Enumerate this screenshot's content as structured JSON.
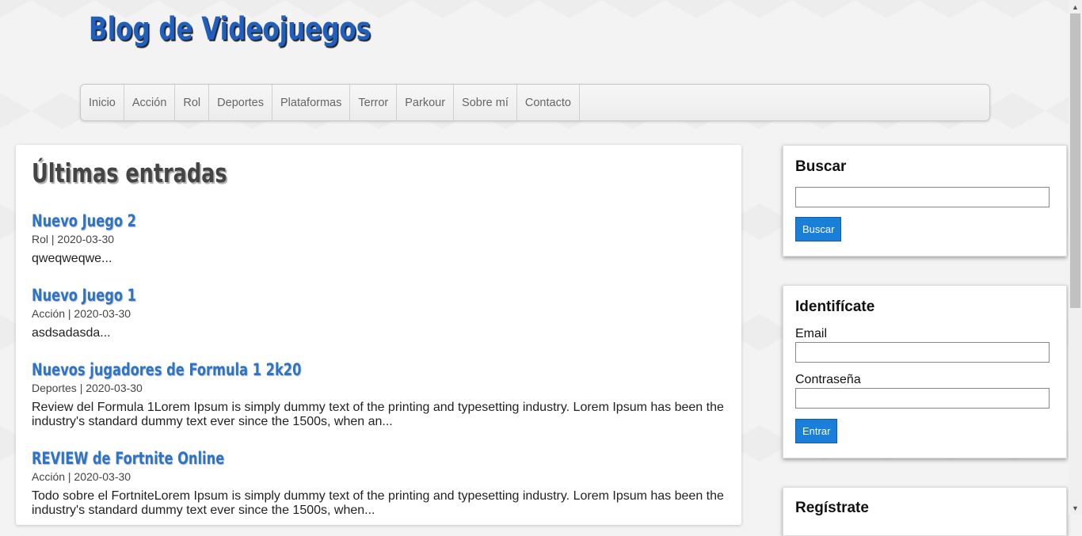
{
  "site": {
    "title": "Blog de Videojuegos"
  },
  "nav": {
    "items": [
      "Inicio",
      "Acción",
      "Rol",
      "Deportes",
      "Plataformas",
      "Terror",
      "Parkour",
      "Sobre mí",
      "Contacto"
    ]
  },
  "main": {
    "heading": "Últimas entradas",
    "posts": [
      {
        "title": "Nuevo Juego 2",
        "meta": "Rol | 2020-03-30",
        "excerpt": "qweqweqwe..."
      },
      {
        "title": "Nuevo Juego 1",
        "meta": "Acción | 2020-03-30",
        "excerpt": "asdsadasda..."
      },
      {
        "title": "Nuevos jugadores de Formula 1 2k20",
        "meta": "Deportes | 2020-03-30",
        "excerpt": "Review del Formula 1Lorem Ipsum is simply dummy text of the printing and typesetting industry. Lorem Ipsum has been the industry's standard dummy text ever since the 1500s, when an..."
      },
      {
        "title": "REVIEW de Fortnite Online",
        "meta": "Acción | 2020-03-30",
        "excerpt": "Todo sobre el FortniteLorem Ipsum is simply dummy text of the printing and typesetting industry. Lorem Ipsum has been the industry's standard dummy text ever since the 1500s, when..."
      }
    ]
  },
  "search_widget": {
    "title": "Buscar",
    "input_value": "",
    "button_label": "Buscar"
  },
  "login_widget": {
    "title": "Identifícate",
    "email_label": "Email",
    "email_value": "",
    "password_label": "Contraseña",
    "password_value": "",
    "button_label": "Entrar"
  },
  "register_widget": {
    "title": "Regístrate"
  },
  "scrollbar": {
    "up_icon": "▲",
    "down_icon": "▼"
  }
}
